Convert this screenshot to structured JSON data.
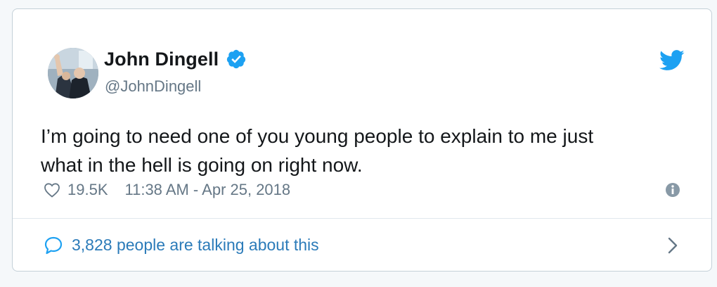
{
  "author": {
    "name": "John Dingell",
    "handle": "@JohnDingell"
  },
  "tweet": {
    "text": "I’m going to need one of you young people to explain to me just\nwhat in the hell is going on right now."
  },
  "meta": {
    "likes": "19.5K",
    "timestamp": "11:38 AM - Apr 25, 2018"
  },
  "footer": {
    "talking": "3,828 people are talking about this"
  },
  "colors": {
    "twitter_blue": "#1da1f2",
    "link_blue": "#2b7bb9",
    "muted_gray": "#657786"
  },
  "icons": [
    "avatar",
    "verified-badge-icon",
    "twitter-bird-icon",
    "heart-icon",
    "info-icon",
    "reply-bubble-icon",
    "chevron-right-icon"
  ]
}
